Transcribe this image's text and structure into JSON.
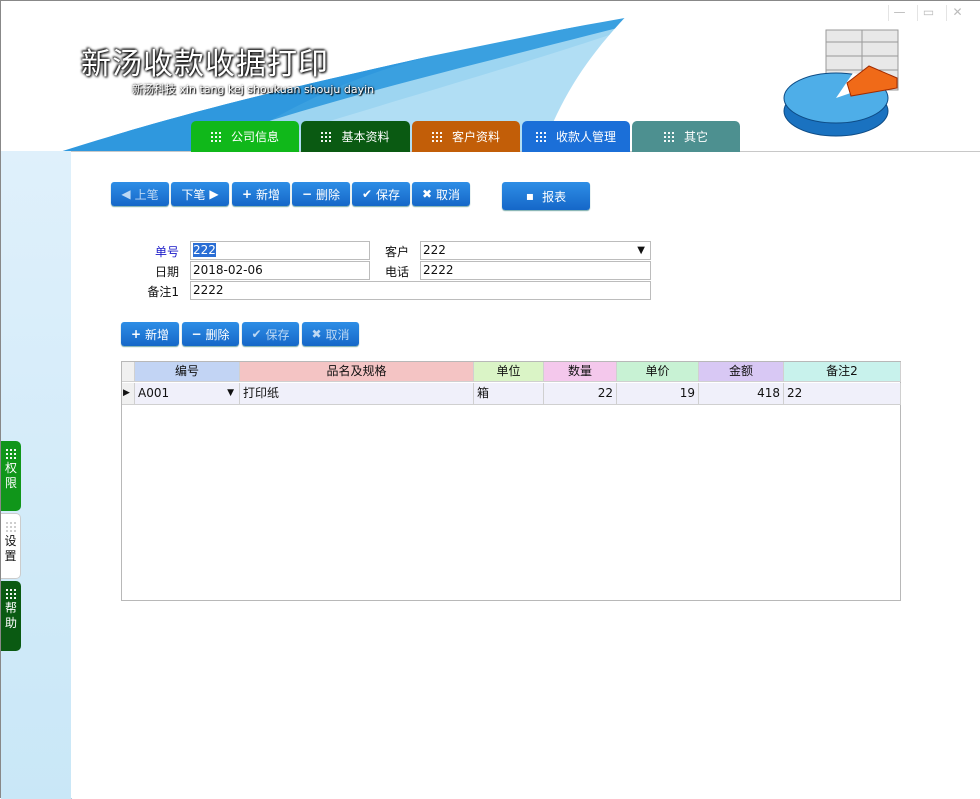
{
  "app": {
    "title": "新汤收款收据打印",
    "subtitle": "新汤科技 xin tang kej shoukuan shouju dayin"
  },
  "window_controls": {
    "minimize": "—",
    "maximize": "▭",
    "close": "✕"
  },
  "tabs": [
    {
      "label": "公司信息",
      "color": "#10b81a"
    },
    {
      "label": "基本资料",
      "color": "#0a5a12"
    },
    {
      "label": "客户资料",
      "color": "#c25e08"
    },
    {
      "label": "收款人管理",
      "color": "#1b6fd8"
    },
    {
      "label": "其它",
      "color": "#4d9090"
    }
  ],
  "side_tabs": [
    {
      "label": "权限"
    },
    {
      "label": "设置"
    },
    {
      "label": "帮助"
    }
  ],
  "toolbar": {
    "prev": "上笔",
    "next": "下笔",
    "add": "新增",
    "delete": "删除",
    "save": "保存",
    "cancel": "取消",
    "report": "报表"
  },
  "form": {
    "order_no_label": "单号",
    "order_no": "222",
    "customer_label": "客户",
    "customer": "222",
    "date_label": "日期",
    "date": "2018-02-06",
    "phone_label": "电话",
    "phone": "2222",
    "note1_label": "备注1",
    "note1": "2222"
  },
  "detail_toolbar": {
    "add": "新增",
    "delete": "删除",
    "save": "保存",
    "cancel": "取消"
  },
  "grid": {
    "columns": [
      "编号",
      "品名及规格",
      "单位",
      "数量",
      "单价",
      "金额",
      "备注2"
    ],
    "rows": [
      {
        "code": "A001",
        "name": "打印纸",
        "unit": "箱",
        "qty": "22",
        "price": "19",
        "amount": "418",
        "note2": "22"
      }
    ]
  }
}
